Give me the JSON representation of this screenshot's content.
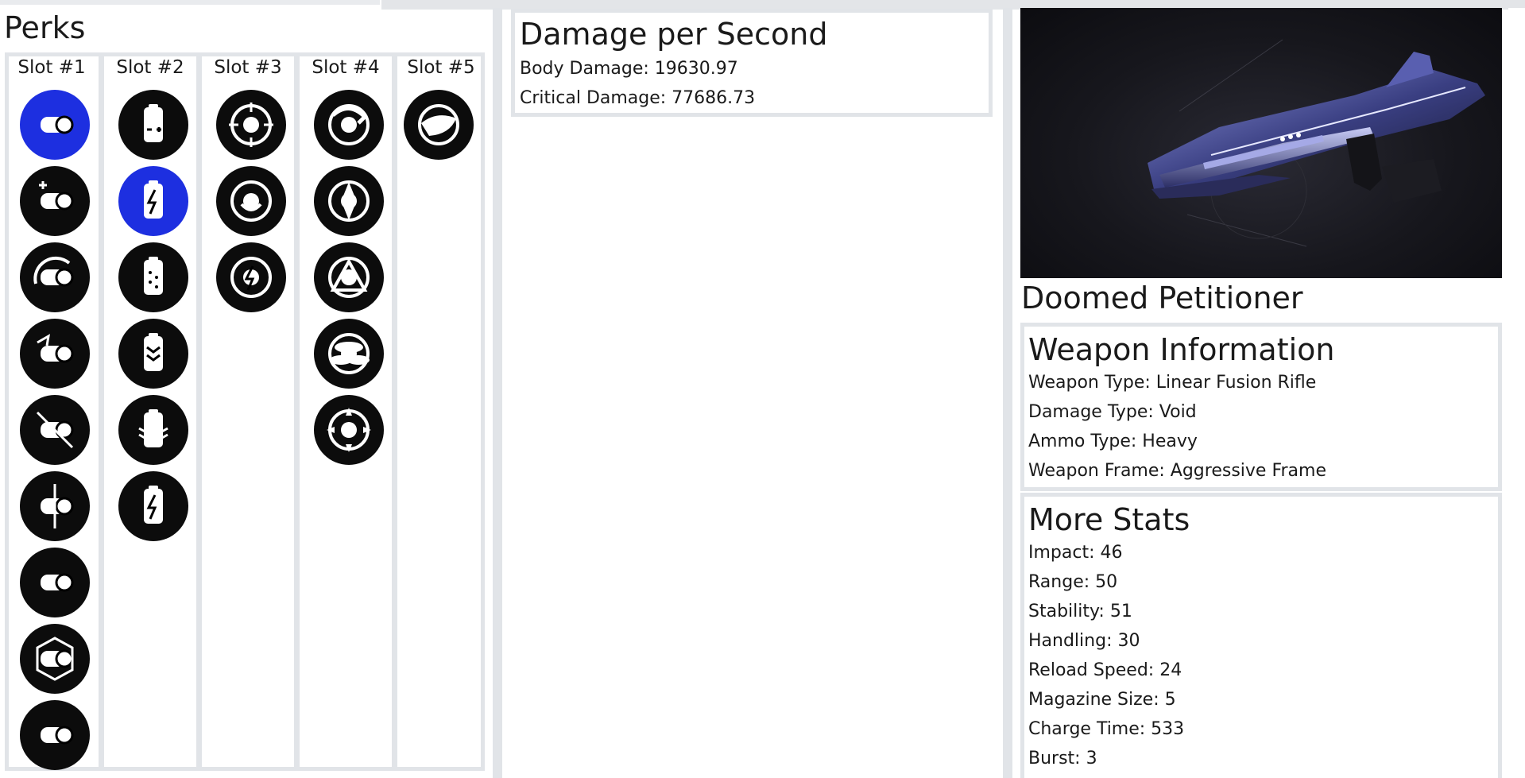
{
  "perks": {
    "title": "Perks",
    "slots": [
      {
        "label": "Slot #1",
        "icons": [
          "barrel-icon",
          "barrel-plus-icon",
          "barrel-swirl-icon",
          "barrel-arrow-icon",
          "barrel-slash-icon",
          "barrel-aim-icon",
          "barrel-fluted-icon",
          "barrel-hex-icon",
          "barrel-flag-icon"
        ],
        "selected": 0
      },
      {
        "label": "Slot #2",
        "icons": [
          "battery-plus-minus-icon",
          "battery-bolt-icon",
          "battery-dots-icon",
          "battery-chevron-icon",
          "battery-layers-icon",
          "battery-lightning-icon"
        ],
        "selected": 1
      },
      {
        "label": "Slot #3",
        "icons": [
          "skull-crosshair-icon",
          "masked-face-icon",
          "circle-bolt-icon"
        ],
        "selected": -1
      },
      {
        "label": "Slot #4",
        "icons": [
          "swirl-arrow-icon",
          "shards-icon",
          "triangle-sigil-icon",
          "coin-stack-icon",
          "target-burst-icon"
        ],
        "selected": -1
      },
      {
        "label": "Slot #5",
        "icons": [
          "masterwork-hand-icon"
        ],
        "selected": -1
      }
    ]
  },
  "dps": {
    "title": "Damage per Second",
    "body": "Body Damage: 19630.97",
    "critical": "Critical Damage: 77686.73"
  },
  "weapon": {
    "name": "Doomed Petitioner",
    "info_title": "Weapon Information",
    "info": [
      "Weapon Type: Linear Fusion Rifle",
      "Damage Type: Void",
      "Ammo Type: Heavy",
      "Weapon Frame: Aggressive Frame"
    ],
    "stats_title": "More Stats",
    "stats": [
      "Impact: 46",
      "Range: 50",
      "Stability: 51",
      "Handling: 30",
      "Reload Speed: 24",
      "Magazine Size: 5",
      "Charge Time: 533",
      "Burst: 3"
    ]
  },
  "colors": {
    "selected_perk": "#1d2fe0",
    "perk_bg": "#0c0c0c",
    "border": "#e1e4e8"
  }
}
